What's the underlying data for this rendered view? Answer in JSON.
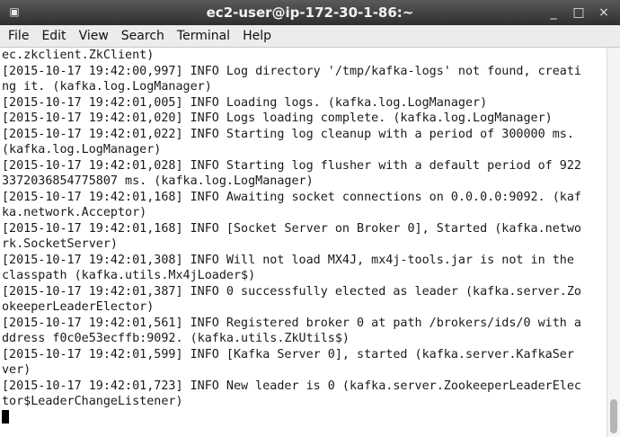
{
  "window": {
    "title": "ec2-user@ip-172-30-1-86:~",
    "icon": "terminal-icon",
    "controls": {
      "minimize": "_",
      "maximize": "□",
      "close": "×"
    }
  },
  "menu": {
    "items": [
      "File",
      "Edit",
      "View",
      "Search",
      "Terminal",
      "Help"
    ]
  },
  "terminal": {
    "lines": [
      "ec.zkclient.ZkClient)",
      "[2015-10-17 19:42:00,997] INFO Log directory '/tmp/kafka-logs' not found, creati",
      "ng it. (kafka.log.LogManager)",
      "[2015-10-17 19:42:01,005] INFO Loading logs. (kafka.log.LogManager)",
      "[2015-10-17 19:42:01,020] INFO Logs loading complete. (kafka.log.LogManager)",
      "[2015-10-17 19:42:01,022] INFO Starting log cleanup with a period of 300000 ms.",
      "(kafka.log.LogManager)",
      "[2015-10-17 19:42:01,028] INFO Starting log flusher with a default period of 922",
      "3372036854775807 ms. (kafka.log.LogManager)",
      "[2015-10-17 19:42:01,168] INFO Awaiting socket connections on 0.0.0.0:9092. (kaf",
      "ka.network.Acceptor)",
      "[2015-10-17 19:42:01,168] INFO [Socket Server on Broker 0], Started (kafka.netwo",
      "rk.SocketServer)",
      "[2015-10-17 19:42:01,308] INFO Will not load MX4J, mx4j-tools.jar is not in the",
      "classpath (kafka.utils.Mx4jLoader$)",
      "[2015-10-17 19:42:01,387] INFO 0 successfully elected as leader (kafka.server.Zo",
      "okeeperLeaderElector)",
      "[2015-10-17 19:42:01,561] INFO Registered broker 0 at path /brokers/ids/0 with a",
      "ddress f0c0e53ecffb:9092. (kafka.utils.ZkUtils$)",
      "[2015-10-17 19:42:01,599] INFO [Kafka Server 0], started (kafka.server.KafkaSer",
      "ver)",
      "[2015-10-17 19:42:01,723] INFO New leader is 0 (kafka.server.ZookeeperLeaderElec",
      "tor$LeaderChangeListener)"
    ]
  }
}
